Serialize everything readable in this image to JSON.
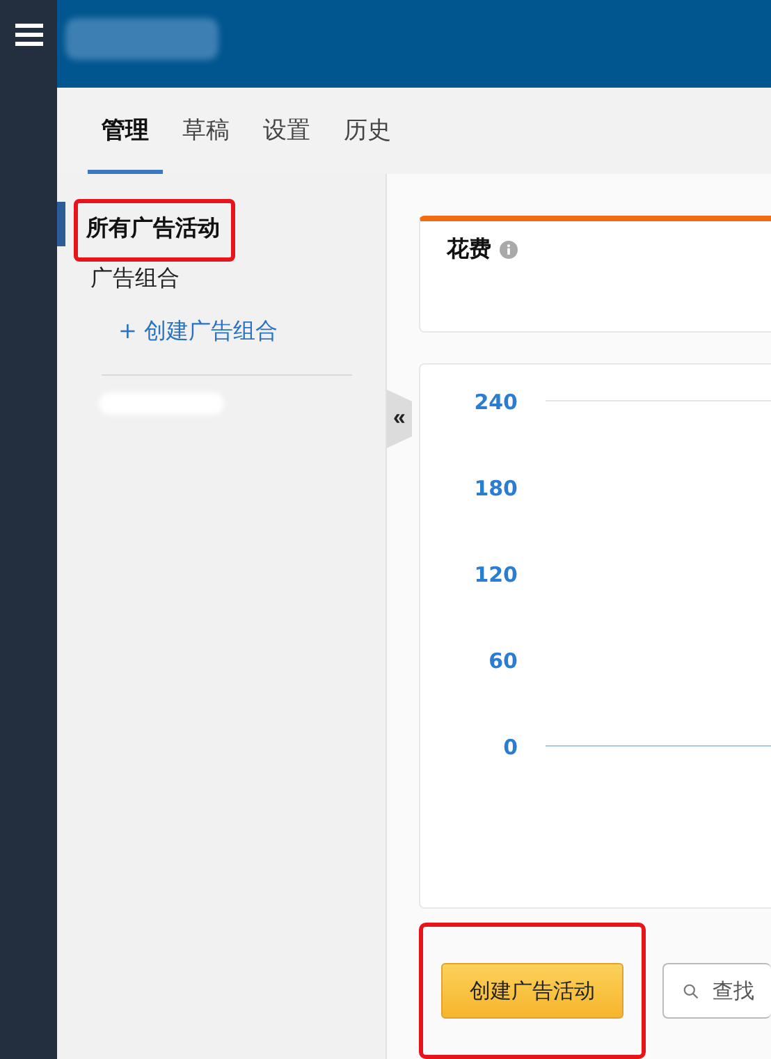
{
  "tabs": [
    {
      "label": "管理",
      "selected": true
    },
    {
      "label": "草稿",
      "selected": false
    },
    {
      "label": "设置",
      "selected": false
    },
    {
      "label": "历史",
      "selected": false
    }
  ],
  "sidebar": {
    "items": [
      {
        "label": "所有广告活动",
        "kind": "item",
        "selected": true,
        "highlighted": true
      },
      {
        "label": "广告组合",
        "kind": "item",
        "selected": false,
        "highlighted": false
      },
      {
        "label": "+ 创建广告组合",
        "kind": "link",
        "selected": false,
        "highlighted": false
      }
    ],
    "collapse_toggle": "«"
  },
  "metric_card": {
    "label": "花费"
  },
  "chart": {
    "y_axis_labels": [
      "240",
      "180",
      "120",
      "60",
      "0"
    ]
  },
  "create_button": {
    "label": "创建广告活动",
    "highlighted": true
  },
  "search": {
    "placeholder": "查找"
  }
}
